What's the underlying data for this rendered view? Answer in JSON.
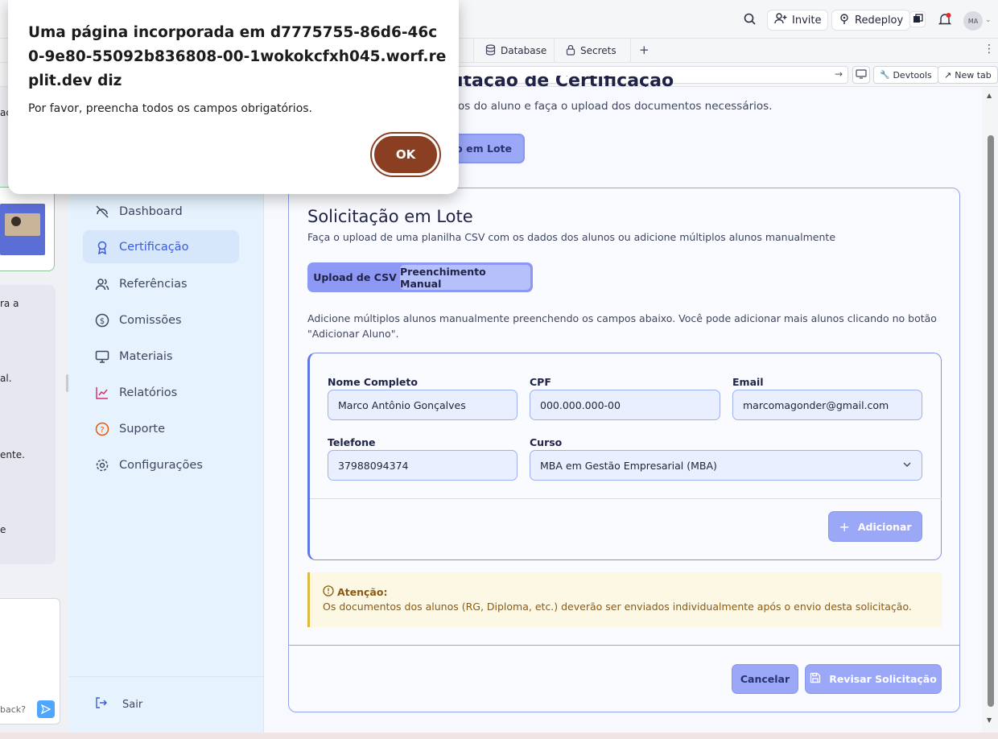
{
  "topbar": {
    "invite_label": "Invite",
    "redeploy_label": "Redeploy",
    "avatar_initials": "MA"
  },
  "tabs": [
    {
      "label": "Database"
    },
    {
      "label": "Secrets"
    }
  ],
  "urlbar": {
    "devtools_label": "Devtools",
    "newtab_label": "New tab"
  },
  "left_panel": {
    "fragments": [
      "aç",
      "ra a",
      "al.",
      "ente.",
      "e",
      "back?"
    ]
  },
  "sidebar": {
    "items": [
      {
        "label": "Dashboard",
        "icon": "dashboard-icon"
      },
      {
        "label": "Certificação",
        "icon": "award-icon",
        "active": true
      },
      {
        "label": "Referências",
        "icon": "users-icon"
      },
      {
        "label": "Comissões",
        "icon": "dollar-icon"
      },
      {
        "label": "Materiais",
        "icon": "monitor-icon"
      },
      {
        "label": "Relatórios",
        "icon": "chart-icon"
      },
      {
        "label": "Suporte",
        "icon": "help-icon"
      },
      {
        "label": "Configurações",
        "icon": "gear-icon"
      }
    ],
    "logout_label": "Sair"
  },
  "page": {
    "title_partial": "itação de Certificação",
    "subtitle_partial": "os do aluno e faça o upload dos documentos necessários.",
    "batch_button_partial": "ão em Lote"
  },
  "card": {
    "title": "Solicitação em Lote",
    "subtitle": "Faça o upload de uma planilha CSV com os dados dos alunos ou adicione múltiplos alunos manualmente",
    "tabs": {
      "csv": "Upload de CSV",
      "manual": "Preenchimento Manual"
    },
    "instructions_line1": "Adicione múltiplos alunos manualmente preenchendo os campos abaixo. Você pode adicionar mais alunos clicando no botão",
    "instructions_line2": "\"Adicionar Aluno\".",
    "form": {
      "name_label": "Nome Completo",
      "name_value": "Marco Antônio Gonçalves",
      "cpf_label": "CPF",
      "cpf_value": "000.000.000-00",
      "email_label": "Email",
      "email_value": "marcomagonder@gmail.com",
      "phone_label": "Telefone",
      "phone_value": "37988094374",
      "course_label": "Curso",
      "course_value": "MBA em Gestão Empresarial (MBA)",
      "add_label": "Adicionar"
    },
    "alert": {
      "title": "Atenção:",
      "text": "Os documentos dos alunos (RG, Diploma, etc.) deverão ser enviados individualmente após o envio desta solicitação."
    },
    "cancel_label": "Cancelar",
    "review_label": "Revisar Solicitação"
  },
  "dialog": {
    "title": "Uma página incorporada em d7775755-86d6-46c0-9e80-55092b836808-00-1wokokcfxh045.worf.replit.dev diz",
    "message": "Por favor, preencha todos os campos obrigatórios.",
    "ok_label": "OK"
  }
}
